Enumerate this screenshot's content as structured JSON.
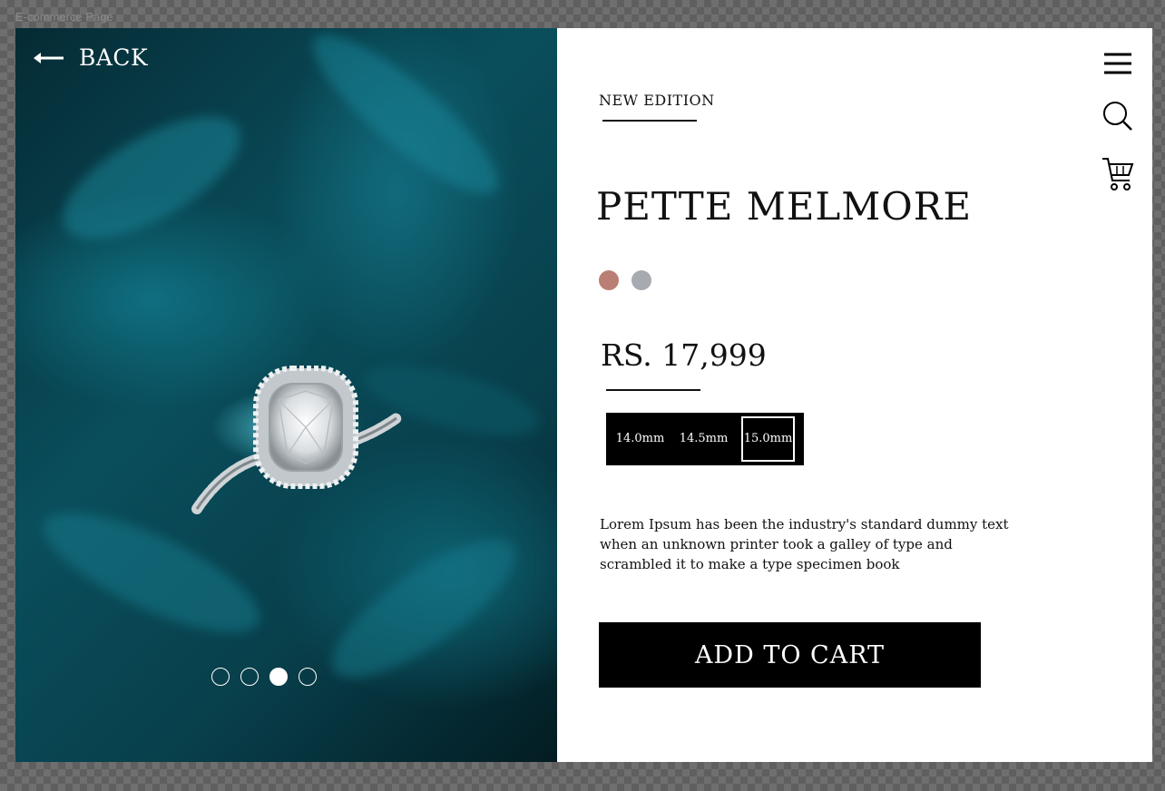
{
  "window": {
    "title": "E-commerce Page"
  },
  "nav": {
    "back_label": "BACK"
  },
  "product": {
    "badge": "NEW EDITION",
    "name": "PETTE MELMORE",
    "price": "RS. 17,999",
    "description": "Lorem Ipsum has been the industry's standard dummy text when an unknown printer took a galley of type and scrambled it to make a type specimen book",
    "colors": [
      {
        "name": "rose-gold",
        "hex": "#b97f74"
      },
      {
        "name": "silver",
        "hex": "#a7aab1"
      }
    ],
    "sizes": [
      "14.0mm",
      "14.5mm",
      "15.0mm"
    ],
    "selected_size": "15.0mm"
  },
  "carousel": {
    "count": 4,
    "active_index": 3
  },
  "actions": {
    "add_to_cart_label": "ADD TO CART"
  },
  "icons": [
    "menu-icon",
    "search-icon",
    "cart-icon",
    "arrow-left-icon"
  ],
  "colors": {
    "panel_bg": "#ffffff",
    "accent": "#000000",
    "hero_teal": "#0a4e5c"
  }
}
